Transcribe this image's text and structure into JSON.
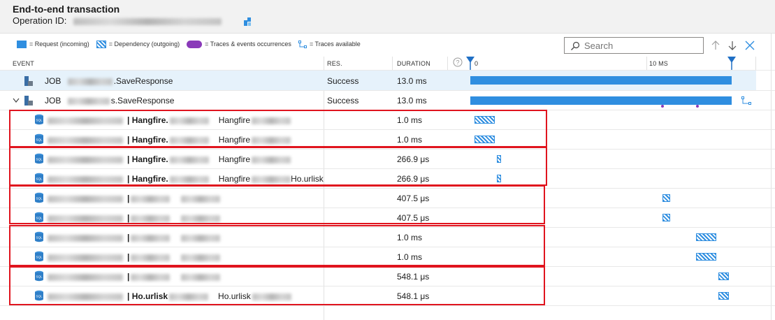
{
  "header": {
    "title": "End-to-end transaction",
    "operation_id_label": "Operation ID:"
  },
  "legend": {
    "request": "= Request (incoming)",
    "dependency": "= Dependency (outgoing)",
    "traces": "= Traces & events occurrences",
    "traces_available": "= Traces available"
  },
  "search": {
    "placeholder": "Search"
  },
  "columns": {
    "event": "EVENT",
    "res": "RES.",
    "duration": "DURATION"
  },
  "timeline": {
    "tick_label": "10 MS",
    "start_label": "0"
  },
  "rows": [
    {
      "name_prefix": "JOB",
      "name_suffix": ".SaveResponse",
      "res": "Success",
      "duration": "13.0 ms"
    },
    {
      "name_prefix": "JOB",
      "name_suffix": "s.SaveResponse",
      "res": "Success",
      "duration": "13.0 ms"
    },
    {
      "bold": "| Hangfire.",
      "target": "Hangfire",
      "duration": "1.0 ms"
    },
    {
      "bold": "| Hangfire.",
      "target": "Hangfire",
      "duration": "1.0 ms"
    },
    {
      "bold": "| Hangfire.",
      "target": "Hangfire",
      "duration": "266.9 μs"
    },
    {
      "bold": "| Hangfire.",
      "target": "Hangfire",
      "target_suffix": "Ho.urlisk",
      "duration": "266.9 μs"
    },
    {
      "bold": "|",
      "duration": "407.5 μs"
    },
    {
      "bold": "|",
      "duration": "407.5 μs"
    },
    {
      "bold": "|",
      "duration": "1.0 ms"
    },
    {
      "bold": "|",
      "duration": "1.0 ms"
    },
    {
      "bold": "|",
      "duration": "548.1 μs"
    },
    {
      "bold": "| Ho.urlisk",
      "target": "Ho.urlisk",
      "duration": "548.1 μs"
    }
  ],
  "colors": {
    "request": "#2f8ee0",
    "trace": "#8a3ab9",
    "highlight": "#e0141e",
    "selected_row": "#e6f2fb"
  }
}
